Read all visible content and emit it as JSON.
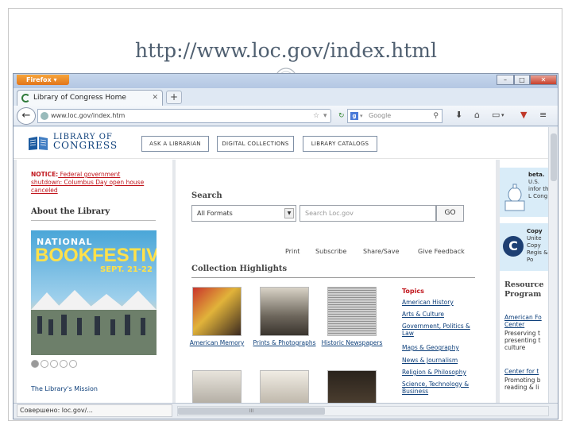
{
  "slide": {
    "title": "http://www.loc.gov/index.html"
  },
  "browser": {
    "app_button": "Firefox",
    "tab_title": "Library of Congress Home",
    "new_tab": "+",
    "url": "www.loc.gov/index.htm",
    "search_placeholder": "Google",
    "status_text": "Совершено: loc.gov/...",
    "controls": {
      "minimize": "–",
      "maximize": "□",
      "close": "✕"
    }
  },
  "header": {
    "logo_line1": "LIBRARY OF",
    "logo_line2": "CONGRESS",
    "buttons": [
      "ASK A LIBRARIAN",
      "DIGITAL COLLECTIONS",
      "LIBRARY CATALOGS"
    ]
  },
  "left": {
    "notice_label": "NOTICE:",
    "notice_text": " Federal government shutdown: Columbus Day open house canceled",
    "about_title": "About the Library",
    "book_festival": {
      "line1": "NATIONAL",
      "line2": "BOOKFESTIVAL",
      "dates": "SEPT. 21-22"
    },
    "mission_link": "The Library's Mission"
  },
  "main": {
    "search_label": "Search",
    "format_select": "All Formats",
    "search_placeholder": "Search Loc.gov",
    "go": "GO",
    "tools": [
      "Print",
      "Subscribe",
      "Share/Save",
      "Give Feedback"
    ],
    "collection_title": "Collection Highlights",
    "collections": [
      {
        "caption": "American Memory"
      },
      {
        "caption": "Prints & Photographs"
      },
      {
        "caption": "Historic Newspapers"
      }
    ],
    "topics_title": "Topics",
    "topics": [
      "American History",
      "Arts & Culture",
      "Government, Politics & Law",
      "Maps & Geography",
      "News & Journalism",
      "Religion & Philosophy",
      "Science, Technology & Business"
    ]
  },
  "right": {
    "beta_title": "beta.",
    "beta_text": "U.S. infor the L Cong",
    "copy_title": "Copy",
    "copy_text": "Unite Copy Regis & Po",
    "resources_title": "Resource Program",
    "resources_link1": "American Fo Center",
    "resources_text1": "Preserving t presenting t culture",
    "resources_link2": "Center for t",
    "resources_text2": "Promoting b reading & li"
  }
}
